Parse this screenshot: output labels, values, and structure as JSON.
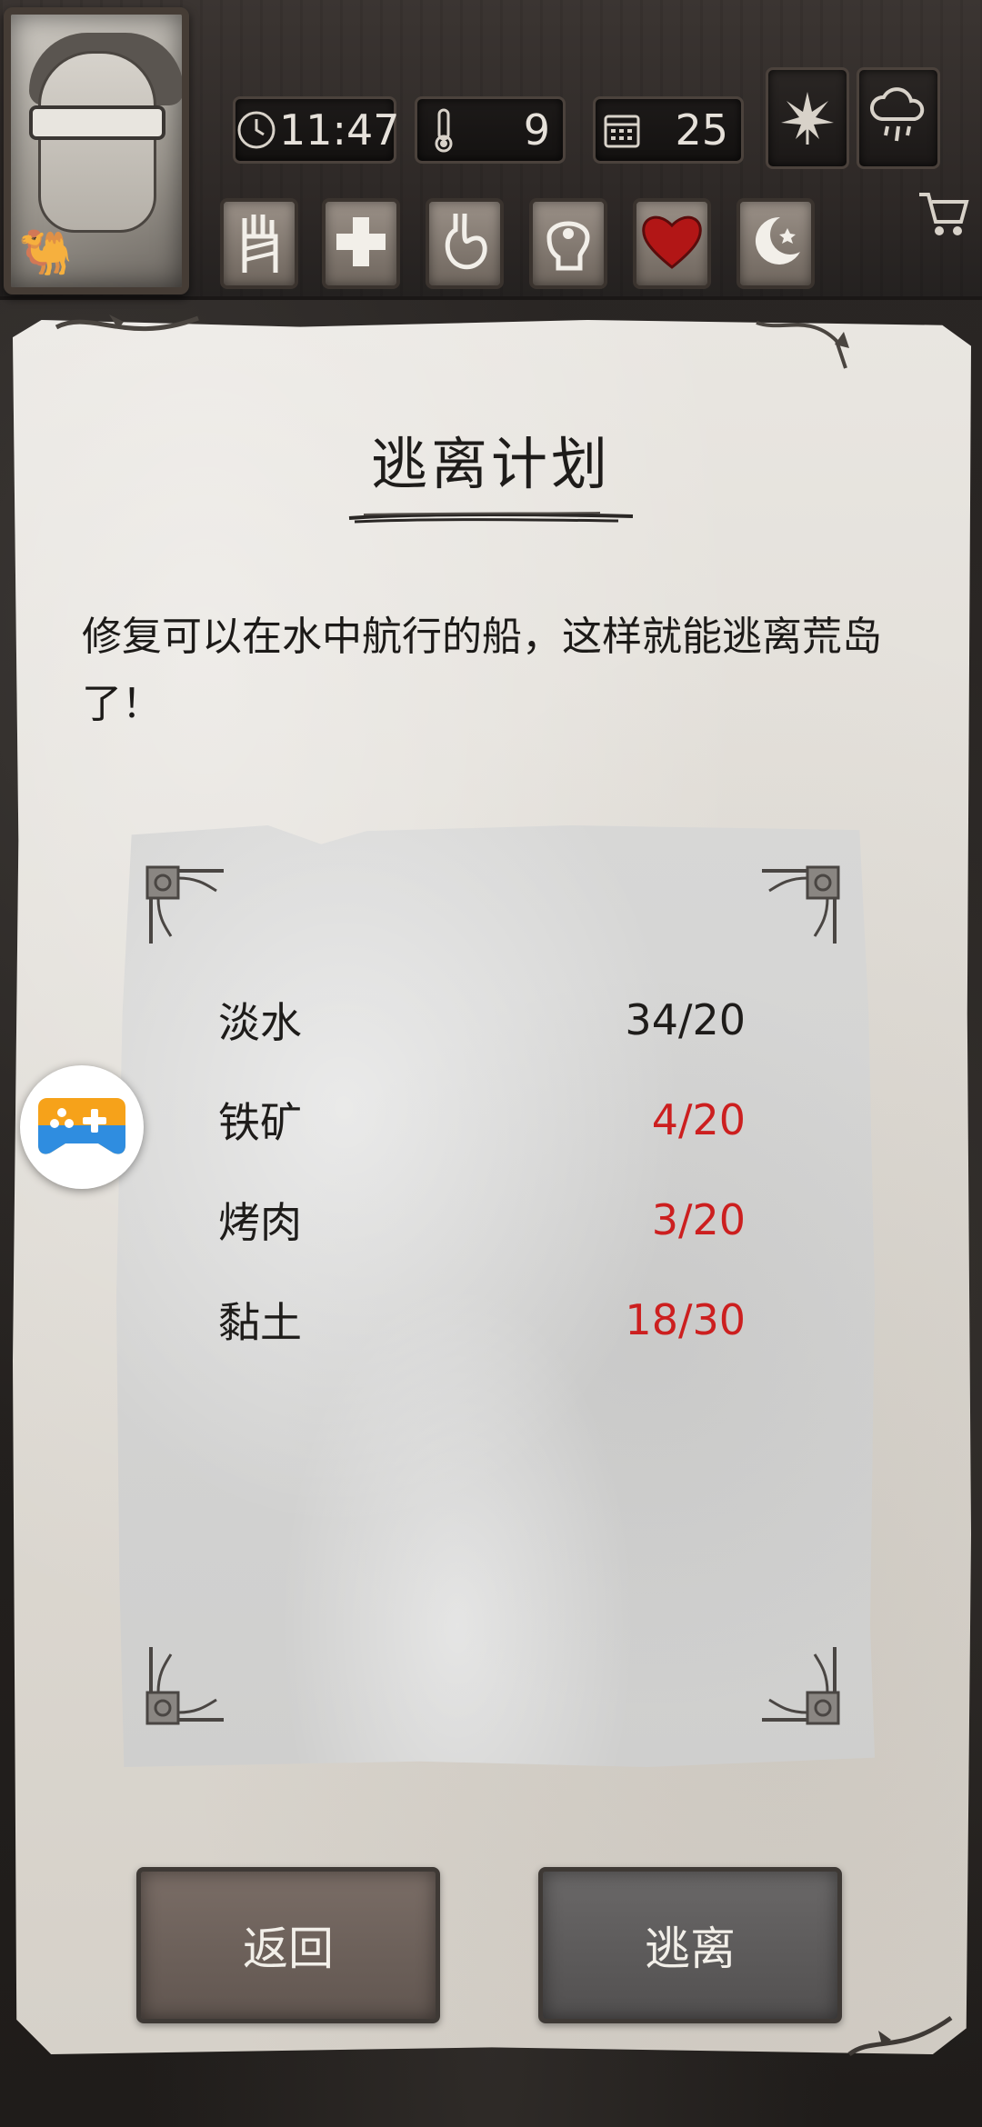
{
  "hud": {
    "time": "11:47",
    "temperature": "9",
    "day": "25",
    "season_icon": "leaf-icon",
    "weather_icon": "rain-cloud-icon",
    "status_icons": [
      "bandage-hand-icon",
      "health-cross-icon",
      "stomach-icon",
      "brain-icon",
      "heart-icon",
      "moon-sleep-icon"
    ],
    "cart_icon": "shopping-cart-icon"
  },
  "dialog": {
    "title": "逃离计划",
    "description": "修复可以在水中航行的船，这样就能逃离荒岛了！"
  },
  "requirements": [
    {
      "name": "淡水",
      "qty": "34/20",
      "sufficient": true
    },
    {
      "name": "铁矿",
      "qty": "4/20",
      "sufficient": false
    },
    {
      "name": "烤肉",
      "qty": "3/20",
      "sufficient": false
    },
    {
      "name": "黏土",
      "qty": "18/30",
      "sufficient": false
    }
  ],
  "buttons": {
    "back_label": "返回",
    "escape_label": "逃离"
  },
  "colors": {
    "insufficient": "#cc1f1f",
    "sufficient": "#1e1c1a"
  }
}
